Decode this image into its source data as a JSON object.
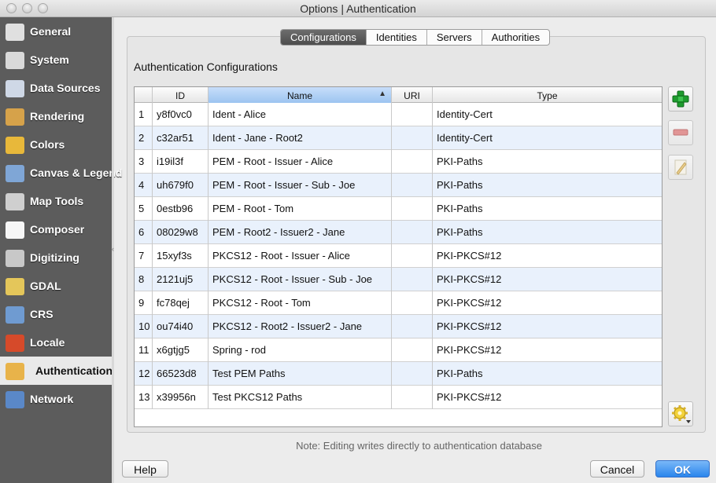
{
  "window": {
    "title": "Options | Authentication"
  },
  "sidebar": {
    "items": [
      {
        "label": "General",
        "icon": "wrench-screwdriver-icon",
        "color": "#e0e0e0"
      },
      {
        "label": "System",
        "icon": "gears-icon",
        "color": "#d9d9d9"
      },
      {
        "label": "Data Sources",
        "icon": "table-icon",
        "color": "#cfd8e6"
      },
      {
        "label": "Rendering",
        "icon": "paintbrush-icon",
        "color": "#d6a24a"
      },
      {
        "label": "Colors",
        "icon": "color-brush-icon",
        "color": "#e8b83a"
      },
      {
        "label": "Canvas & Legend",
        "icon": "canvas-icon",
        "color": "#7fa6d6"
      },
      {
        "label": "Map Tools",
        "icon": "map-tools-icon",
        "color": "#cfcfcf"
      },
      {
        "label": "Composer",
        "icon": "composer-icon",
        "color": "#f6f6f6"
      },
      {
        "label": "Digitizing",
        "icon": "digitizing-icon",
        "color": "#c8c8c8"
      },
      {
        "label": "GDAL",
        "icon": "gdal-icon",
        "color": "#e4c65a"
      },
      {
        "label": "CRS",
        "icon": "globe-icon",
        "color": "#6f9bd1"
      },
      {
        "label": "Locale",
        "icon": "locale-flags-icon",
        "color": "#d64a2a"
      },
      {
        "label": "Authentication",
        "icon": "padlock-icon",
        "color": "#e8b34a"
      },
      {
        "label": "Network",
        "icon": "network-icon",
        "color": "#5a88c8"
      }
    ],
    "selected_index": 12
  },
  "tabs": [
    {
      "label": "Configurations",
      "active": true
    },
    {
      "label": "Identities",
      "active": false
    },
    {
      "label": "Servers",
      "active": false
    },
    {
      "label": "Authorities",
      "active": false
    }
  ],
  "section": {
    "title": "Authentication Configurations"
  },
  "table": {
    "columns": [
      "ID",
      "Name",
      "URI",
      "Type"
    ],
    "sorted_column": "Name",
    "rows": [
      {
        "num": "1",
        "id": "y8f0vc0",
        "name": "Ident - Alice",
        "uri": "",
        "type": "Identity-Cert"
      },
      {
        "num": "2",
        "id": "c32ar51",
        "name": "Ident - Jane - Root2",
        "uri": "",
        "type": "Identity-Cert"
      },
      {
        "num": "3",
        "id": "i19il3f",
        "name": "PEM - Root - Issuer - Alice",
        "uri": "",
        "type": "PKI-Paths"
      },
      {
        "num": "4",
        "id": "uh679f0",
        "name": "PEM - Root - Issuer - Sub - Joe",
        "uri": "",
        "type": "PKI-Paths"
      },
      {
        "num": "5",
        "id": "0estb96",
        "name": "PEM - Root - Tom",
        "uri": "",
        "type": "PKI-Paths"
      },
      {
        "num": "6",
        "id": "08029w8",
        "name": "PEM - Root2 - Issuer2 - Jane",
        "uri": "",
        "type": "PKI-Paths"
      },
      {
        "num": "7",
        "id": "15xyf3s",
        "name": "PKCS12 - Root - Issuer - Alice",
        "uri": "",
        "type": "PKI-PKCS#12"
      },
      {
        "num": "8",
        "id": "2121uj5",
        "name": "PKCS12 - Root - Issuer - Sub - Joe",
        "uri": "",
        "type": "PKI-PKCS#12"
      },
      {
        "num": "9",
        "id": "fc78qej",
        "name": "PKCS12 - Root - Tom",
        "uri": "",
        "type": "PKI-PKCS#12"
      },
      {
        "num": "10",
        "id": "ou74i40",
        "name": "PKCS12 - Root2 - Issuer2 - Jane",
        "uri": "",
        "type": "PKI-PKCS#12"
      },
      {
        "num": "11",
        "id": "x6gtjg5",
        "name": "Spring - rod",
        "uri": "",
        "type": "PKI-PKCS#12"
      },
      {
        "num": "12",
        "id": "66523d8",
        "name": "Test PEM Paths",
        "uri": "",
        "type": "PKI-Paths"
      },
      {
        "num": "13",
        "id": "x39956n",
        "name": "Test PKCS12 Paths",
        "uri": "",
        "type": "PKI-PKCS#12"
      }
    ]
  },
  "side_buttons": [
    {
      "icon": "add-plus-icon",
      "enabled": true
    },
    {
      "icon": "remove-minus-icon",
      "enabled": false
    },
    {
      "icon": "edit-pencil-icon",
      "enabled": false
    },
    {
      "icon": "gear-menu-icon",
      "enabled": true
    }
  ],
  "note": "Note: Editing writes directly to authentication database",
  "buttons": {
    "help": "Help",
    "cancel": "Cancel",
    "ok": "OK"
  },
  "colors": {
    "accent": "#2a85ec",
    "sidebar": "#5c5c5c",
    "row_alt": "#e9f1fc",
    "add_green": "#1e9b2e",
    "remove_red": "#d05050"
  }
}
